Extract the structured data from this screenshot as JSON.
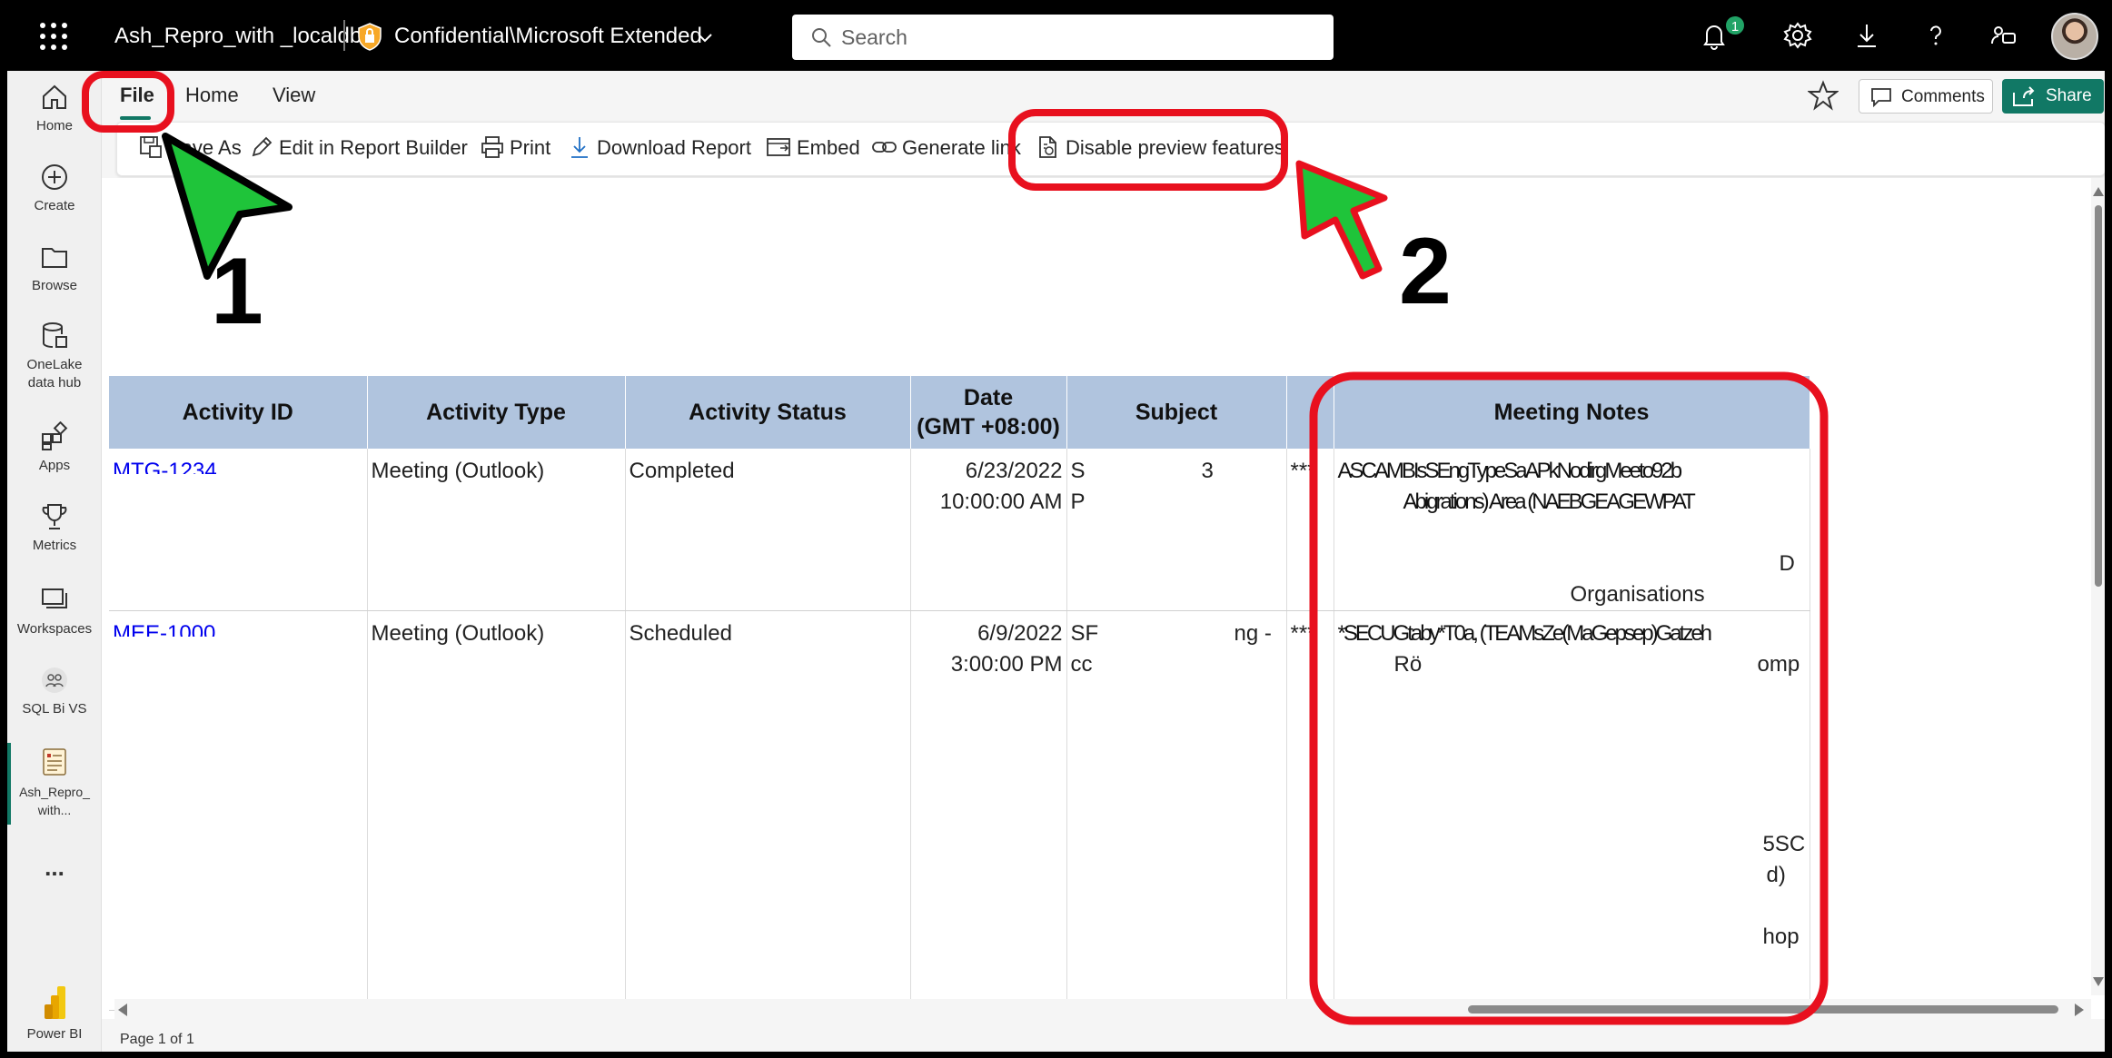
{
  "topbar": {
    "report_title": "Ash_Repro_with _localdb",
    "sensitivity_label": "Confidential\\Microsoft Extended",
    "search_placeholder": "Search",
    "notification_count": "1"
  },
  "leftnav": {
    "items": [
      {
        "label": "Home"
      },
      {
        "label": "Create"
      },
      {
        "label": "Browse"
      },
      {
        "label": "OneLake data hub"
      },
      {
        "label": "Apps"
      },
      {
        "label": "Metrics"
      },
      {
        "label": "Workspaces"
      },
      {
        "label": "SQL Bi VS"
      },
      {
        "label": "Ash_Repro_ with..."
      },
      {
        "label": "..."
      },
      {
        "label": "Power BI"
      }
    ]
  },
  "menu": {
    "tabs": [
      {
        "label": "File"
      },
      {
        "label": "Home"
      },
      {
        "label": "View"
      }
    ],
    "comments_label": "Comments",
    "share_label": "Share"
  },
  "toolbar": {
    "save_as": "Save As",
    "edit_in_report_builder": "Edit in Report Builder",
    "print": "Print",
    "download_report": "Download Report",
    "embed": "Embed",
    "generate_link": "Generate link",
    "disable_preview": "Disable preview features"
  },
  "report": {
    "columns": [
      "Activity ID",
      "Activity Type",
      "Activity Status",
      "Date (GMT +08:00)",
      "Subject",
      "",
      "Meeting Notes"
    ],
    "date_header_line1": "Date",
    "date_header_line2": "(GMT +08:00)",
    "rows": [
      {
        "id": "MTG-1234",
        "type": "Meeting (Outlook)",
        "status": "Completed",
        "date": "6/23/2022",
        "time": "10:00:00 AM",
        "subject_a": "S",
        "subject_b": "P",
        "subject_num": "3",
        "stars": "***",
        "notes_line1": "ASCAMBIsSEngTypeSaAPkNodirgMeeto92b",
        "notes_line2": "Abigrations) Area (NAEBGEAGEWPAT",
        "notes_line3": "D",
        "notes_line4": "Organisations"
      },
      {
        "id": "MEE-1000",
        "type": "Meeting (Outlook)",
        "status": "Scheduled",
        "date": "6/9/2022",
        "time": "3:00:00 PM",
        "subject_a": "SF",
        "subject_b": "cc",
        "subject_num": "ng -",
        "stars": "***",
        "notes_line1": "*SECUGtaby*T0a, (TEAMsZe(MaGepsep)Gatzeh",
        "notes_line2": "Rö",
        "notes_line2b": "omp",
        "notes_line3": "5SC",
        "notes_line4": "d)",
        "notes_line5": "hop"
      }
    ]
  },
  "footer": {
    "page_info": "Page 1 of 1"
  },
  "annotations": {
    "step1": "1",
    "step2": "2",
    "highlight_color": "#e8101e",
    "arrow_color": "#1fc43a"
  }
}
